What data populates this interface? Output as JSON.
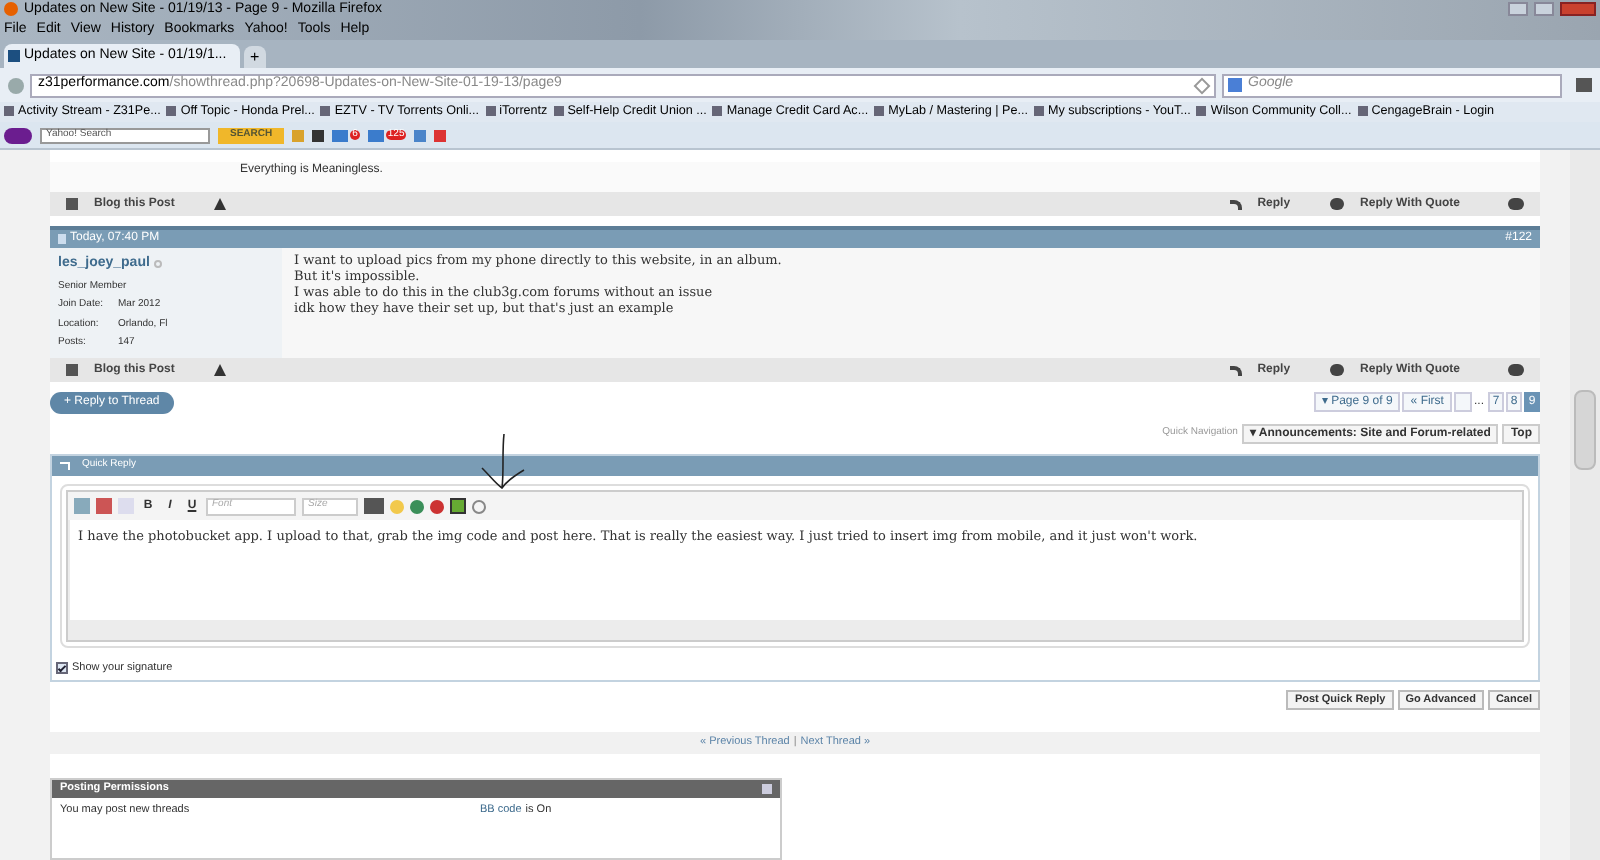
{
  "window": {
    "title": "Updates on New Site - 01/19/13 - Page 9 - Mozilla Firefox"
  },
  "menu": [
    "File",
    "Edit",
    "View",
    "History",
    "Bookmarks",
    "Yahoo!",
    "Tools",
    "Help"
  ],
  "tabs": [
    {
      "label": "Updates on New Site - 01/19/1...",
      "selected": true
    }
  ],
  "new_tab": "+",
  "address_bar": {
    "host": "z31performance.com",
    "path": "/showthread.php?20698-Updates-on-New-Site-01-19-13/page9"
  },
  "search": {
    "placeholder": "Google"
  },
  "bookmarks": [
    "Activity Stream - Z31Pe...",
    "Off Topic - Honda Prel...",
    "EZTV - TV Torrents Onli...",
    "iTorrentz",
    "Self-Help Credit Union ...",
    "Manage Credit Card Ac...",
    "MyLab / Mastering | Pe...",
    "My subscriptions - YouT...",
    "Wilson Community Coll...",
    "CengageBrain - Login"
  ],
  "yahoo_toolbar": {
    "placeholder": "Yahoo! Search",
    "button": "SEARCH",
    "badges": [
      "6",
      "125"
    ]
  },
  "previous_post": {
    "signature": "Everything is Meaningless.",
    "blog": "Blog this Post",
    "reply": "Reply",
    "quote": "Reply With Quote"
  },
  "post": {
    "date": "Today, 07:40 PM",
    "number": "#122",
    "author": "les_joey_paul",
    "online": false,
    "rank": "Senior Member",
    "details": [
      {
        "label": "Join Date:",
        "value": "Mar 2012"
      },
      {
        "label": "Location:",
        "value": "Orlando, Fl"
      },
      {
        "label": "Posts:",
        "value": "147"
      }
    ],
    "lines": [
      "I want to upload pics from my phone directly to this website, in an album.",
      "But it's impossible.",
      "I was able to do this in the club3g.com forums without an issue",
      "idk how they have their set up, but that's just an example"
    ],
    "blog": "Blog this Post",
    "reply": "Reply",
    "quote": "Reply With Quote"
  },
  "reply_to_thread": "+ Reply to Thread",
  "pagination": {
    "caret": "▾",
    "first_mark": "«",
    "summary": "Page 9 of 9",
    "first": "First",
    "ellipsis": "...",
    "pages": [
      {
        "label": "7",
        "selected": false
      },
      {
        "label": "8",
        "selected": false
      },
      {
        "label": "9",
        "selected": true
      }
    ]
  },
  "quick_navigation": {
    "label": "Quick Navigation",
    "caret": "▾",
    "menu": "Announcements: Site and Forum-related",
    "top": "Top"
  },
  "quick_reply": {
    "title": "Quick Reply",
    "format_buttons": [
      {
        "kind": "bold",
        "label": "B"
      },
      {
        "kind": "italic",
        "label": "I"
      },
      {
        "kind": "underline",
        "label": "U"
      }
    ],
    "font": "Font",
    "size": "Size",
    "text": "I have the photobucket app. I upload to that, grab the img code and post here. That is really the easiest way. I just tried to insert img from mobile, and it just won't work.",
    "show_signature": {
      "label": "Show your signature",
      "checked": true
    },
    "buttons": [
      "Post Quick Reply",
      "Go Advanced",
      "Cancel"
    ]
  },
  "thread_nav": {
    "previous": "« Previous Thread",
    "separator": "|",
    "next": "Next Thread »"
  },
  "posting_permissions": {
    "title": "Posting Permissions",
    "rule": "You may post new threads",
    "bb_code": "BB code",
    "bb_state": "is On"
  }
}
